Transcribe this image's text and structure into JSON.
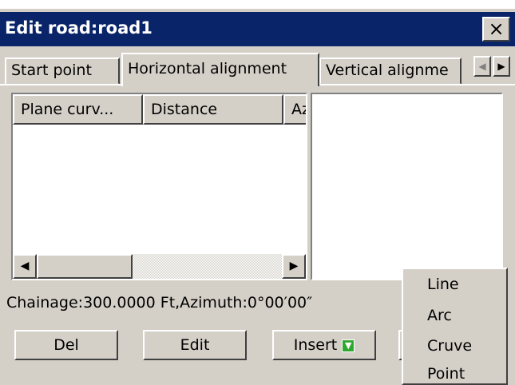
{
  "window": {
    "title": "Edit road:road1",
    "close_label": "×"
  },
  "tabs": [
    {
      "label": "Start point"
    },
    {
      "label": "Horizontal alignment"
    },
    {
      "label": "Vertical alignme"
    }
  ],
  "tab_scroll": {
    "left": "◀",
    "right": "▶"
  },
  "list": {
    "columns": [
      "Plane curv...",
      "Distance",
      "Az"
    ],
    "rows": [],
    "scroll_left": "◀",
    "scroll_right": "▶"
  },
  "status_text": "Chainage:300.0000 Ft,Azimuth:0°00′00″",
  "buttons": {
    "del": "Del",
    "edit": "Edit",
    "insert": "Insert"
  },
  "insert_menu": [
    "Line",
    "Arc",
    "Cruve",
    "Point"
  ],
  "colors": {
    "titlebar": "#0a246a",
    "face": "#d4d0c8",
    "insert_icon": "#2ea82e"
  }
}
